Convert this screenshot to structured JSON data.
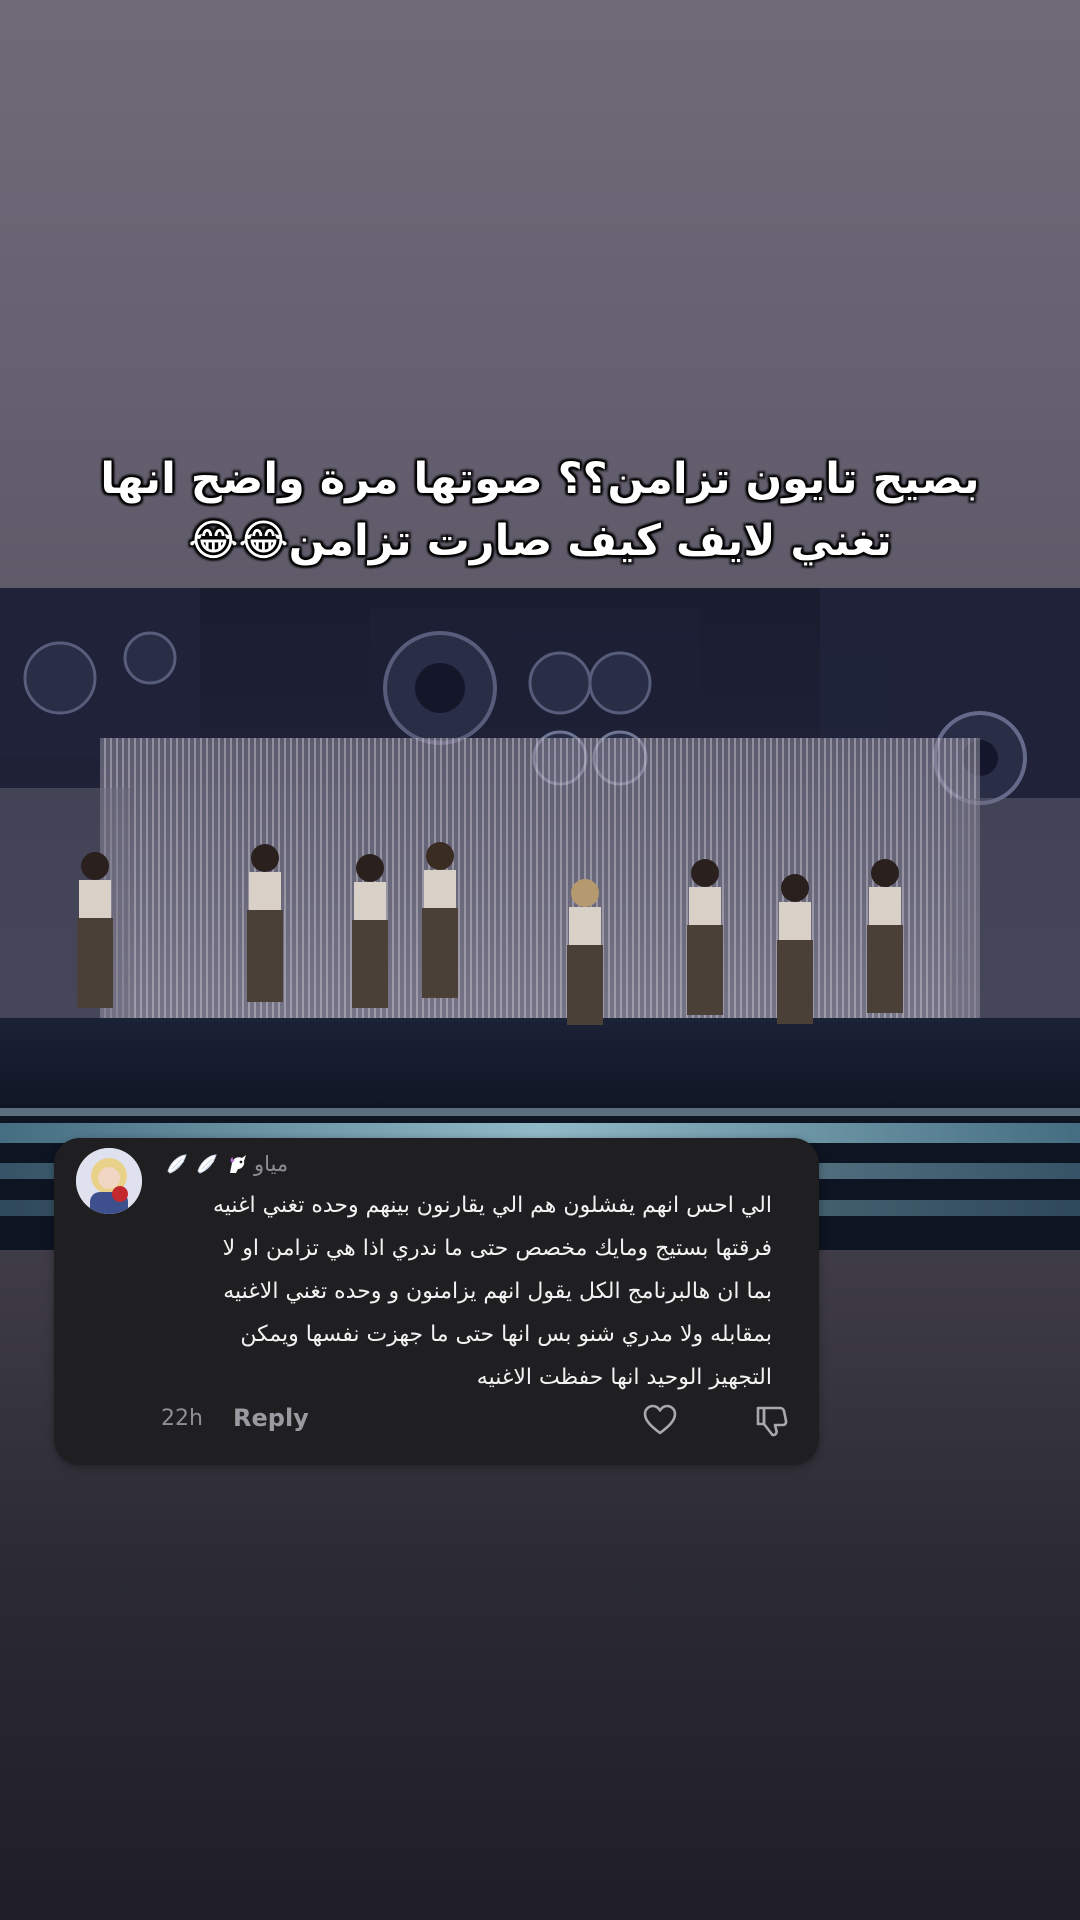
{
  "caption": {
    "line1": "بصيح تايون تزامن؟؟ صوتها مرة واضح انها",
    "line2": "تغني لايف كيف صارت تزامن😂😂"
  },
  "video": {
    "description_icon": "concert-stage-video"
  },
  "comment": {
    "username": "مياو",
    "username_emojis": [
      "unicorn-icon",
      "wing-icon",
      "wing-icon"
    ],
    "body_lines": [
      "الي احس انهم يفشلون هم الي يقارنون بينهم وحده تغني اغنيه",
      "فرقتها بستيج ومايك مخصص حتى ما ندري اذا هي تزامن او لا",
      "بما ان هالبرنامج الكل يقول انهم يزامنون و وحده تغني الاغنيه",
      "بمقابله ولا مدري شنو بس انها حتى ما جهزت نفسها ويمكن",
      "التجهيز الوحيد انها حفظت الاغنيه"
    ],
    "timestamp": "22h",
    "reply_label": "Reply",
    "like_icon": "heart-icon",
    "dislike_icon": "thumbs-down-icon"
  }
}
